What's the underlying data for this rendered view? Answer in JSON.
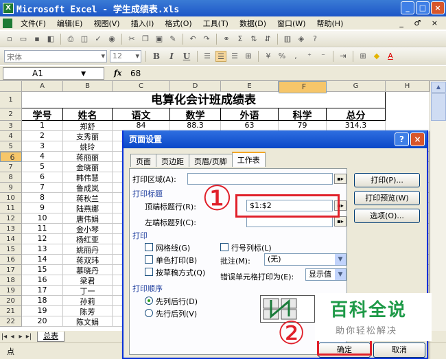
{
  "window": {
    "title": "Microsoft Excel - 学生成绩表.xls",
    "app_icon": "X"
  },
  "menu": [
    "文件(F)",
    "编辑(E)",
    "视图(V)",
    "插入(I)",
    "格式(O)",
    "工具(T)",
    "数据(D)",
    "窗口(W)",
    "帮助(H)"
  ],
  "menu_right": "_ ♂ ×",
  "font_name": "宋体",
  "font_size": "12",
  "format_buttons": [
    "B",
    "I",
    "U"
  ],
  "name_box": "A1",
  "fx": "fx",
  "formula_value": "68",
  "columns": [
    "A",
    "B",
    "C",
    "D",
    "E",
    "F",
    "G",
    "H"
  ],
  "sheet_title": "电算化会计班成绩表",
  "header_row": [
    "学号",
    "姓名",
    "语文",
    "数学",
    "外语",
    "科学",
    "总分"
  ],
  "row1_values": [
    "1",
    "郑舒",
    "84",
    "88.3",
    "63",
    "79",
    "314.3"
  ],
  "student_rows": [
    [
      "2",
      "支秀丽"
    ],
    [
      "3",
      "姚玲"
    ],
    [
      "4",
      "蒋丽丽"
    ],
    [
      "5",
      "金晓丽"
    ],
    [
      "6",
      "韩伟慧"
    ],
    [
      "7",
      "鲁成岚"
    ],
    [
      "8",
      "蒋秋兰"
    ],
    [
      "9",
      "陆燕娜"
    ],
    [
      "10",
      "唐伟娟"
    ],
    [
      "11",
      "金小琴"
    ],
    [
      "12",
      "杨红亚"
    ],
    [
      "13",
      "姚丽丹"
    ],
    [
      "14",
      "蒋双玮"
    ],
    [
      "15",
      "慕晓丹"
    ],
    [
      "16",
      "梁君"
    ],
    [
      "17",
      "丁一"
    ],
    [
      "18",
      "孙莉"
    ],
    [
      "19",
      "陈芳"
    ],
    [
      "20",
      "陈文娟"
    ]
  ],
  "row_numbers": [
    "1",
    "2",
    "3",
    "4",
    "5",
    "6",
    "7",
    "8",
    "9",
    "10",
    "11",
    "12",
    "13",
    "14",
    "15",
    "16",
    "17",
    "18",
    "19",
    "20",
    "21",
    "22"
  ],
  "sheet_tab": "总表",
  "status": "点",
  "dialog": {
    "title": "页面设置",
    "help": "?",
    "close": "×",
    "tabs": [
      "页面",
      "页边距",
      "页眉/页脚",
      "工作表"
    ],
    "print_area_label": "打印区域(A):",
    "print_titles_label": "打印标题",
    "top_rows_label": "顶端标题行(R):",
    "top_rows_value": "$1:$2",
    "left_cols_label": "左端标题列(C):",
    "print_label": "打印",
    "gridlines_label": "网格线(G)",
    "rowcol_headers_label": "行号列标(L)",
    "mono_label": "单色打印(B)",
    "comments_label": "批注(M):",
    "comments_value": "(无)",
    "draft_label": "按草稿方式(Q)",
    "errors_label": "错误单元格打印为(E):",
    "errors_value": "显示值",
    "order_label": "打印顺序",
    "down_then_over": "先列后行(D)",
    "over_then_down": "先行后列(V)",
    "btn_print": "打印(P)...",
    "btn_preview": "打印预览(W)",
    "btn_options": "选项(O)...",
    "btn_ok": "确定",
    "btn_cancel": "取消"
  },
  "annotations": {
    "step1": "①",
    "step2": "②"
  },
  "watermark": {
    "big": "百科全说",
    "small": "助你轻松解决"
  }
}
